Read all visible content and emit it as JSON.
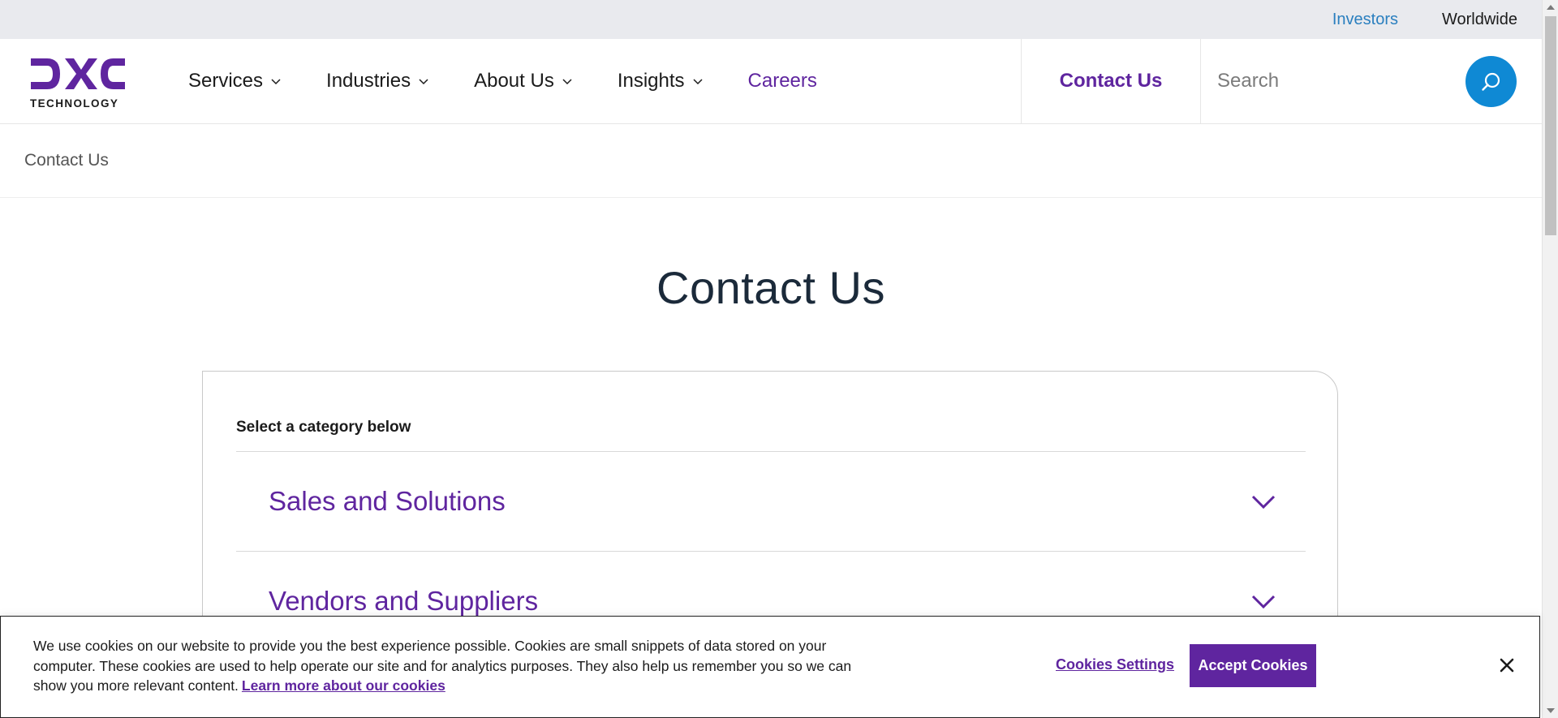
{
  "utility": {
    "investors": "Investors",
    "worldwide": "Worldwide"
  },
  "brand": {
    "logo_text": "TECHNOLOGY",
    "color_purple": "#5f259f",
    "color_blue": "#0f89d4"
  },
  "nav": {
    "items": [
      {
        "label": "Services",
        "has_dropdown": true
      },
      {
        "label": "Industries",
        "has_dropdown": true
      },
      {
        "label": "About Us",
        "has_dropdown": true
      },
      {
        "label": "Insights",
        "has_dropdown": true
      },
      {
        "label": "Careers",
        "has_dropdown": false
      }
    ],
    "contact_us": "Contact Us",
    "search_placeholder": "Search"
  },
  "breadcrumb": {
    "current": "Contact Us"
  },
  "page": {
    "title": "Contact Us"
  },
  "card": {
    "category_label": "Select a category below",
    "accordions": [
      {
        "label": "Sales and Solutions",
        "icon": "chevron-down-icon"
      },
      {
        "label": "Vendors and Suppliers",
        "icon": "chevron-down-icon"
      }
    ]
  },
  "cookie_banner": {
    "text": "We use cookies on our website to provide you the best experience possible. Cookies are small snippets of data stored on your computer. These cookies are used to help operate our site and for analytics purposes. They also help us remember you so we can show you more relevant content.",
    "learn_more": "Learn more about our cookies",
    "settings_label": "Cookies Settings",
    "accept_label": "Accept Cookies"
  }
}
